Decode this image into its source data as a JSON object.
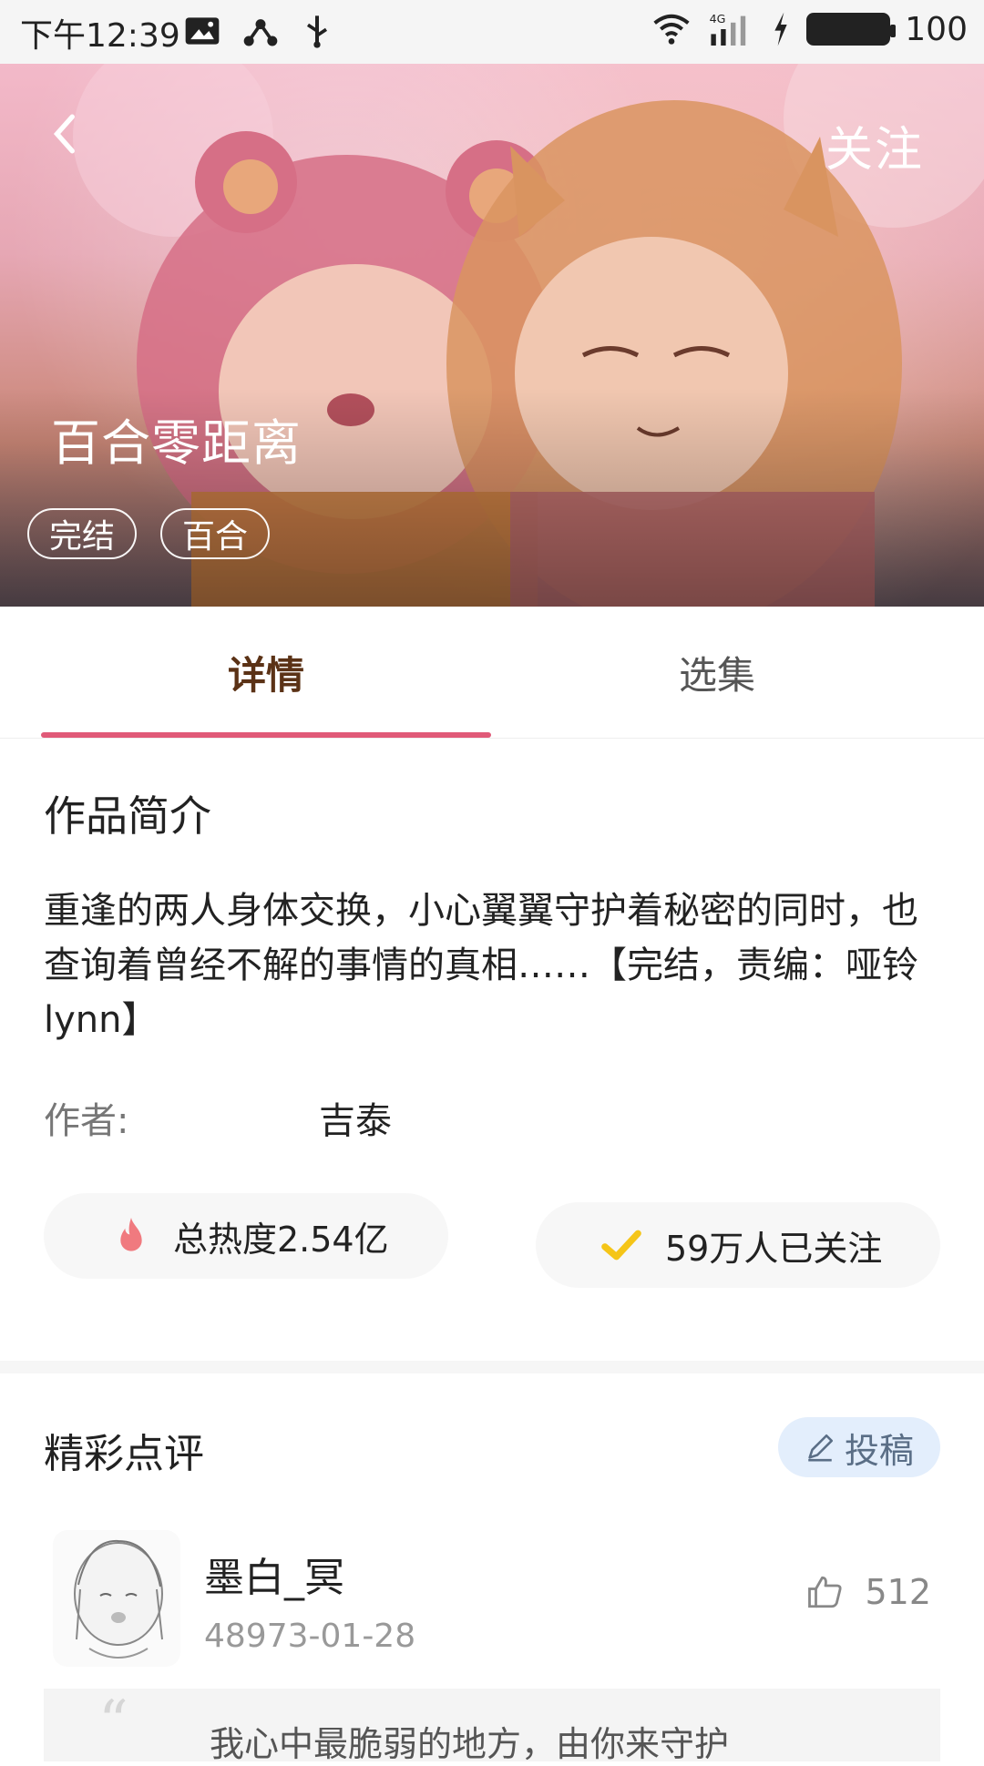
{
  "status_bar": {
    "time": "下午12:39",
    "battery": "100"
  },
  "hero": {
    "back_icon": "chevron-left-icon",
    "follow_label": "关注",
    "title": "百合零距离",
    "tags": [
      "完结",
      "百合"
    ]
  },
  "tabs": [
    {
      "label": "详情",
      "active": true
    },
    {
      "label": "选集",
      "active": false
    }
  ],
  "detail": {
    "section_title": "作品简介",
    "synopsis": "重逢的两人身体交换，小心翼翼守护着秘密的同时，也查询着曾经不解的事情的真相……【完结，责编：哑铃lynn】",
    "author_label": "作者:",
    "author_name": "吉泰",
    "heat": {
      "icon": "flame-icon",
      "text": "总热度2.54亿"
    },
    "followers": {
      "icon": "check-icon",
      "text": "59万人已关注"
    }
  },
  "reviews": {
    "title": "精彩点评",
    "submit_label": "投稿",
    "submit_icon": "pen-icon",
    "items": [
      {
        "name": "墨白_冥",
        "date": "48973-01-28",
        "likes": "512",
        "like_icon": "thumb-up-icon",
        "quote": "我心中最脆弱的地方，由你来守护"
      }
    ]
  },
  "colors": {
    "accent": "#e05a78",
    "tab_active_text": "#5b3216",
    "follow_check": "#f5c518",
    "flame": "#f07a7f",
    "submit_bg": "#e3eefc"
  }
}
